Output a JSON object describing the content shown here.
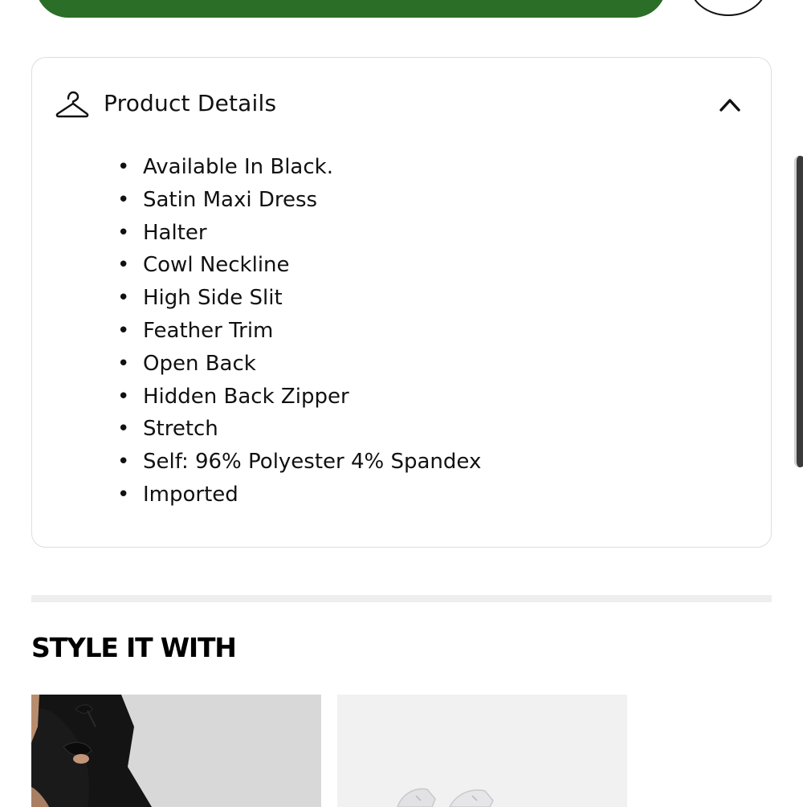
{
  "details": {
    "title": "Product Details",
    "icon": "hanger-icon",
    "toggle_icon": "chevron-up-icon",
    "expanded": true,
    "items": [
      "Available In Black.",
      "Satin Maxi Dress",
      "Halter",
      "Cowl Neckline",
      "High Side Slit",
      "Feather Trim",
      "Open Back",
      "Hidden Back Zipper",
      "Stretch",
      "Self: 96% Polyester 4% Spandex",
      "Imported"
    ]
  },
  "style_section": {
    "title": "STYLE IT WITH"
  },
  "colors": {
    "cta_green": "#2b6e27",
    "card_border": "#dddddd",
    "divider": "#eeeeee",
    "text": "#111111"
  }
}
